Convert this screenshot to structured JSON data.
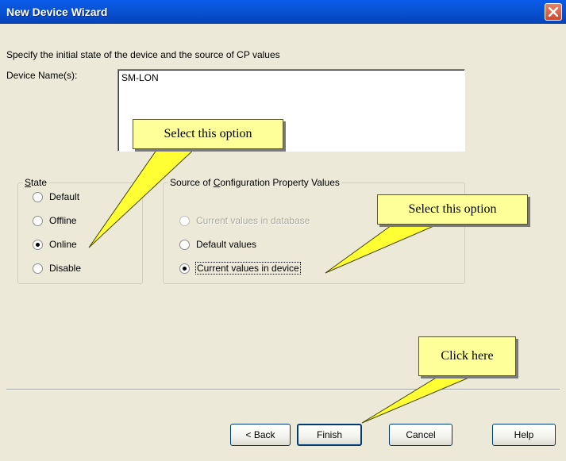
{
  "window": {
    "title": "New Device Wizard",
    "close_icon": "close-x-icon"
  },
  "instruction": "Specify the initial state of the device and the source of CP values",
  "device_name": {
    "label": "Device Name(s):",
    "value": "SM-LON"
  },
  "state_group": {
    "label": "State",
    "options": [
      {
        "label": "Default",
        "checked": false
      },
      {
        "label": "Offline",
        "checked": false
      },
      {
        "label": "Online",
        "checked": true
      },
      {
        "label": "Disable",
        "checked": false
      }
    ]
  },
  "source_group": {
    "label": "Source of Configuration Property Values",
    "options": [
      {
        "label": "Current values in database",
        "checked": false,
        "disabled": true
      },
      {
        "label": "Default values",
        "checked": false,
        "disabled": false
      },
      {
        "label": "Current values in device",
        "checked": true,
        "disabled": false
      }
    ]
  },
  "buttons": {
    "back": "< Back",
    "finish": "Finish",
    "cancel": "Cancel",
    "help": "Help"
  },
  "callouts": {
    "state": "Select this option",
    "source": "Select this option",
    "finish": "Click here"
  },
  "colors": {
    "titlebar": "#0A5BEA",
    "dialog_bg": "#ECE9D8",
    "callout_fill": "#FFFF99"
  }
}
